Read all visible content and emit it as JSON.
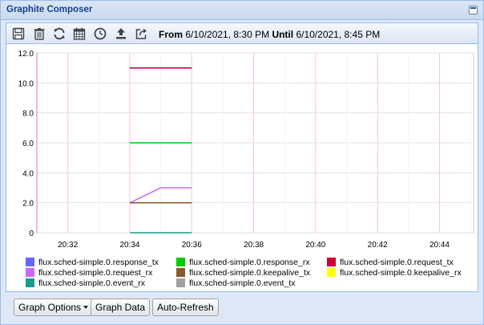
{
  "window": {
    "title": "Graphite Composer"
  },
  "toolbar": {
    "icons": [
      "save-icon",
      "trash-icon",
      "refresh-icon",
      "calendar-icon",
      "clock-icon",
      "upload-icon",
      "share-icon"
    ],
    "from_label": "From",
    "from_value": "6/10/2021, 8:30 PM",
    "until_label": "Until",
    "until_value": "6/10/2021, 8:45 PM"
  },
  "buttons": {
    "graph_options": "Graph Options",
    "graph_data": "Graph Data",
    "auto_refresh": "Auto-Refresh"
  },
  "chart_data": {
    "type": "line",
    "grid": true,
    "legend_position": "bottom",
    "ylim": [
      0,
      12
    ],
    "y_ticks": [
      "0",
      "2.0",
      "4.0",
      "6.0",
      "8.0",
      "10.0",
      "12.0"
    ],
    "x_ticks": [
      "20:32",
      "20:34",
      "20:36",
      "20:38",
      "20:40",
      "20:42",
      "20:44"
    ],
    "series": [
      {
        "name": "flux.sched-simple.0.response_tx",
        "color": "#6666ff",
        "points": [
          [
            "20:34",
            11
          ],
          [
            "20:35",
            11
          ],
          [
            "20:36",
            11
          ]
        ]
      },
      {
        "name": "flux.sched-simple.0.response_rx",
        "color": "#00cc00",
        "points": [
          [
            "20:34",
            6
          ],
          [
            "20:35",
            6
          ],
          [
            "20:36",
            6
          ]
        ]
      },
      {
        "name": "flux.sched-simple.0.request_tx",
        "color": "#cc0033",
        "points": [
          [
            "20:34",
            11
          ],
          [
            "20:35",
            11
          ],
          [
            "20:36",
            11
          ]
        ]
      },
      {
        "name": "flux.sched-simple.0.request_rx",
        "color": "#cc66ff",
        "points": [
          [
            "20:34",
            2
          ],
          [
            "20:35",
            3
          ],
          [
            "20:36",
            3
          ]
        ]
      },
      {
        "name": "flux.sched-simple.0.keepalive_tx",
        "color": "#8b5a2b",
        "points": [
          [
            "20:34",
            2
          ],
          [
            "20:35",
            2
          ],
          [
            "20:36",
            2
          ]
        ]
      },
      {
        "name": "flux.sched-simple.0.keepalive_rx",
        "color": "#ffff00",
        "points": []
      },
      {
        "name": "flux.sched-simple.0.event_rx",
        "color": "#1a9a8a",
        "points": [
          [
            "20:34",
            0
          ],
          [
            "20:35",
            0
          ],
          [
            "20:36",
            0
          ]
        ]
      },
      {
        "name": "flux.sched-simple.0.event_tx",
        "color": "#a0a0a0",
        "points": []
      }
    ]
  }
}
